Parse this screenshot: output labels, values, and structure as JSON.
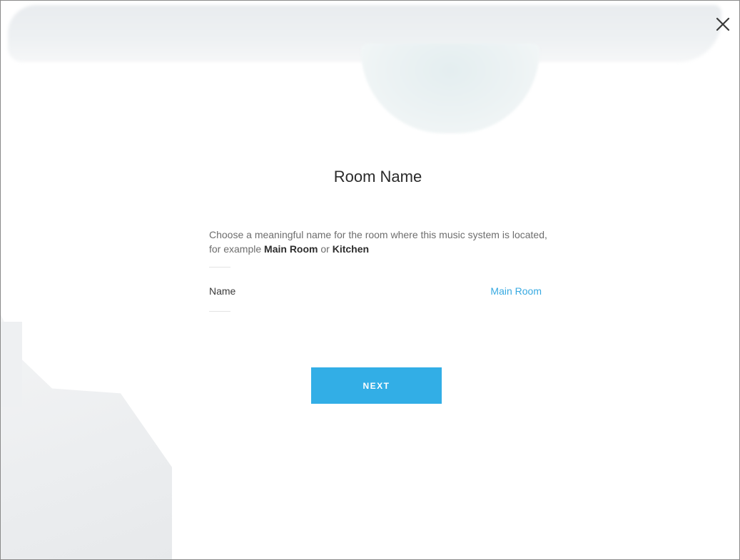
{
  "dialog": {
    "title": "Room Name",
    "description": {
      "prefix": "Choose a meaningful name for the room where this music system is located, for example ",
      "example1": "Main Room",
      "joiner": " or ",
      "example2": "Kitchen"
    },
    "field": {
      "label": "Name",
      "value": "Main Room"
    },
    "next_label": "NEXT",
    "close_icon": "close-icon"
  },
  "colors": {
    "accent": "#32aee6",
    "value_text": "#37a9e1"
  }
}
